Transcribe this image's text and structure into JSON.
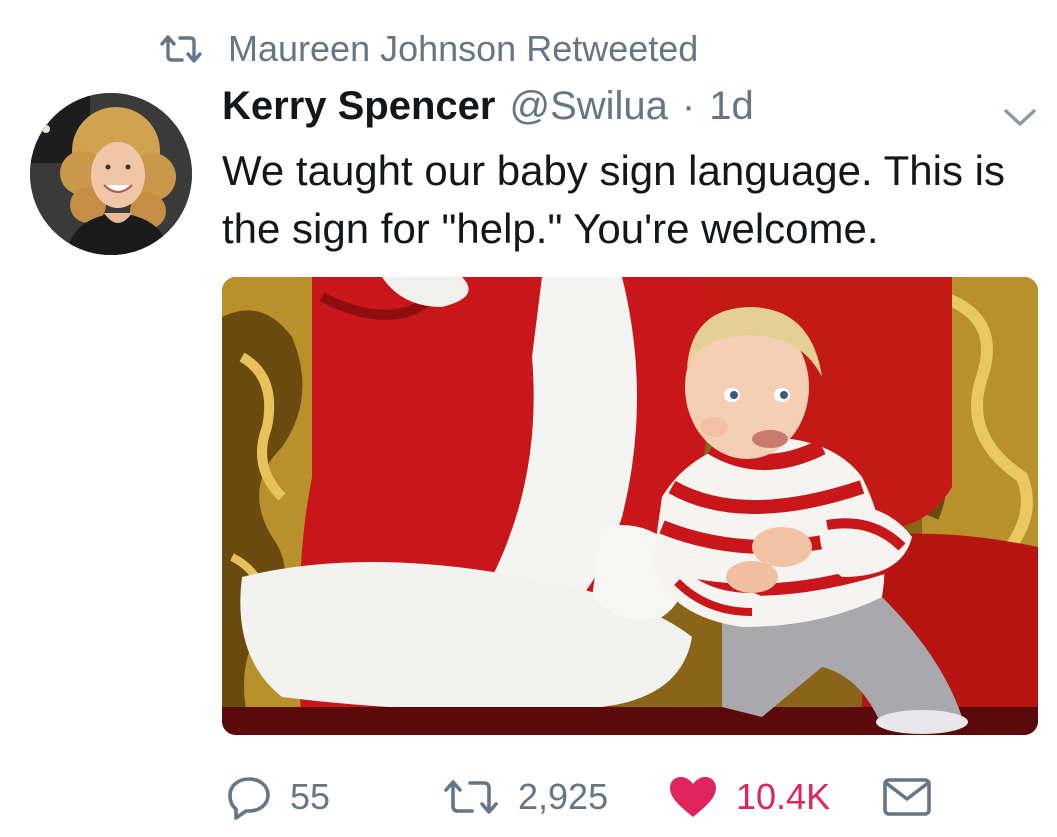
{
  "retweet_context": {
    "icon": "retweet-icon",
    "text": "Maureen Johnson Retweeted"
  },
  "tweet": {
    "author_name": "Kerry Spencer",
    "author_handle": "@Swilua",
    "separator": "·",
    "timestamp": "1d",
    "text": "We taught our baby sign language. This is the sign for \"help.\" You're welcome.",
    "media_icon": "photo",
    "more_icon": "chevron-down-icon"
  },
  "actions": {
    "reply": {
      "icon": "reply-icon",
      "count": "55"
    },
    "retweet": {
      "icon": "retweet-icon",
      "count": "2,925"
    },
    "like": {
      "icon": "heart-icon",
      "count": "10.4K",
      "liked": true
    },
    "dm": {
      "icon": "envelope-icon"
    }
  },
  "colors": {
    "text": "#14171a",
    "secondary": "#657786",
    "like_active": "#e0245e"
  }
}
